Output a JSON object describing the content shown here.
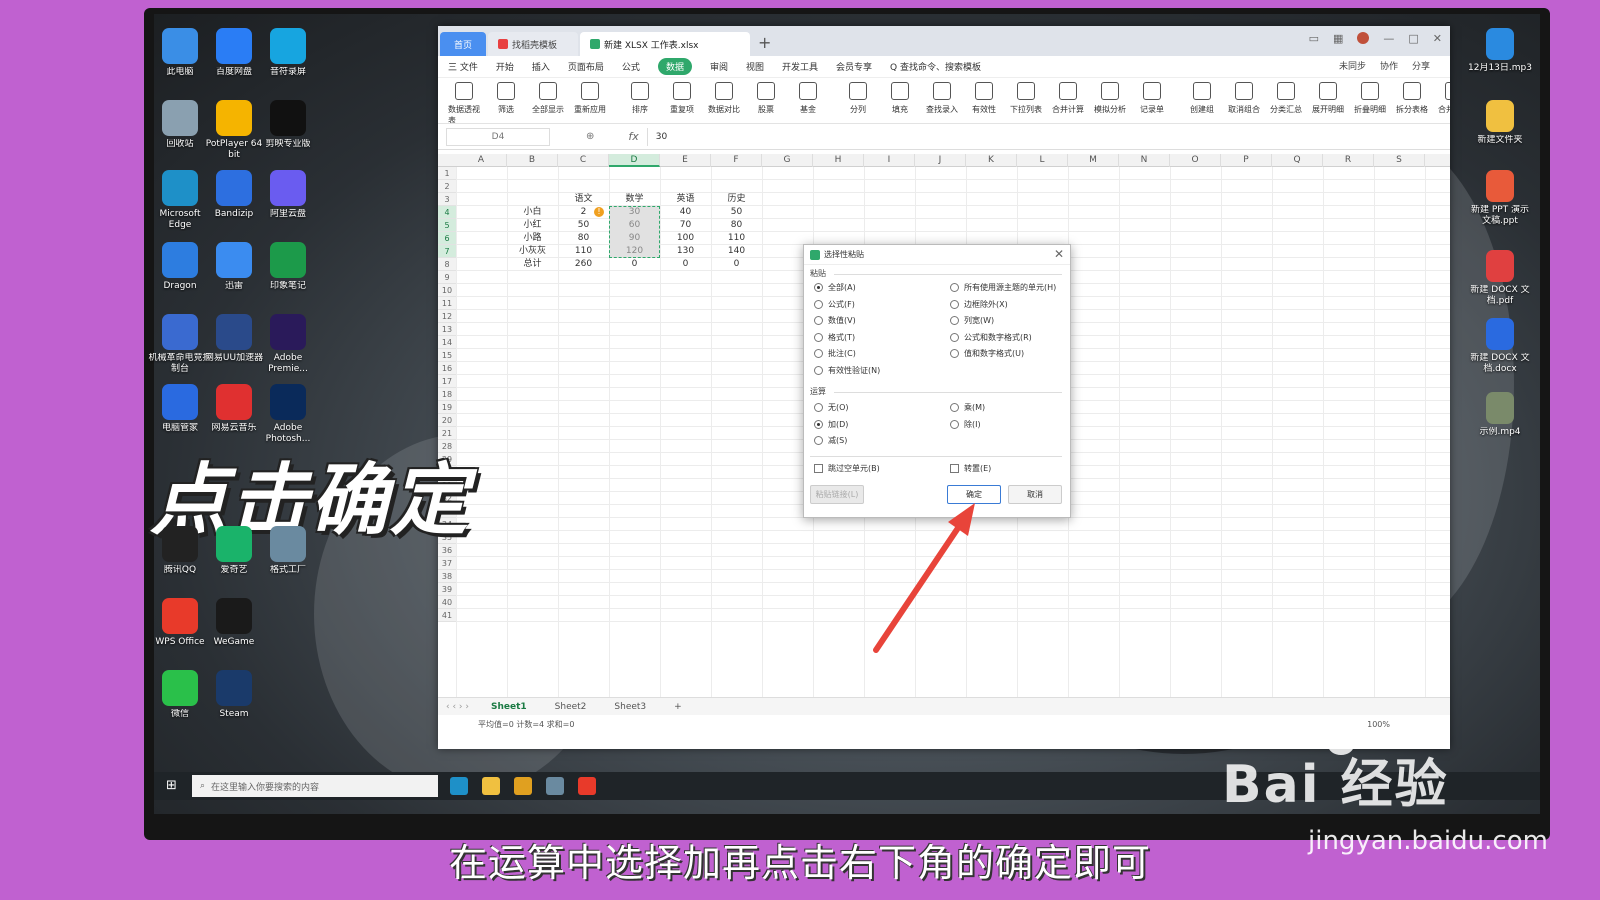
{
  "desktop": {
    "left_icons": [
      {
        "name": "此电脑",
        "color": "#3a8ee6"
      },
      {
        "name": "百度网盘",
        "color": "#2a7df5"
      },
      {
        "name": "音符录屏",
        "color": "#17a5e0"
      },
      {
        "name": "回收站",
        "color": "#8aa0b0"
      },
      {
        "name": "PotPlayer 64 bit",
        "color": "#f5b400"
      },
      {
        "name": "剪映专业版",
        "color": "#111111"
      },
      {
        "name": "Microsoft Edge",
        "color": "#1e90c8"
      },
      {
        "name": "Bandizip",
        "color": "#2d6fe0"
      },
      {
        "name": "阿里云盘",
        "color": "#6a5cf0"
      },
      {
        "name": "Dragon",
        "color": "#2d7de0"
      },
      {
        "name": "迅雷",
        "color": "#3b8cf0"
      },
      {
        "name": "印象笔记",
        "color": "#1c9a4a"
      },
      {
        "name": "机械革命电竞控制台",
        "color": "#3a6ad0"
      },
      {
        "name": "网易UU加速器",
        "color": "#2a4a8a"
      },
      {
        "name": "Adobe Premie...",
        "color": "#2a1a5a"
      },
      {
        "name": "电脑管家",
        "color": "#2a6ae0"
      },
      {
        "name": "网易云音乐",
        "color": "#e03030"
      },
      {
        "name": "Adobe Photosh...",
        "color": "#0a2a5a"
      },
      {
        "name": "腾讯QQ",
        "color": "#222222"
      },
      {
        "name": "爱奇艺",
        "color": "#1ab36a"
      },
      {
        "name": "格式工厂",
        "color": "#6a8aa0"
      },
      {
        "name": "WPS Office",
        "color": "#e83a2a"
      },
      {
        "name": "WeGame",
        "color": "#1a1a1a"
      },
      {
        "name": "微信",
        "color": "#2ac04a"
      },
      {
        "name": "Steam",
        "color": "#1a3a6a"
      }
    ],
    "right_icons": [
      {
        "name": "12月13日.mp3",
        "color": "#2a8ae0"
      },
      {
        "name": "新建文件夹",
        "color": "#f0c040"
      },
      {
        "name": "新建 PPT 演示文稿.ppt",
        "color": "#e85a3a"
      },
      {
        "name": "新建 DOCX 文档.pdf",
        "color": "#e04040"
      },
      {
        "name": "新建 DOCX 文档.docx",
        "color": "#2a6ae0"
      },
      {
        "name": "示例.mp4",
        "color": "#7a8a6a"
      }
    ]
  },
  "excel": {
    "tabs": {
      "home": "首页",
      "template": "找稻壳模板",
      "document": "新建 XLSX 工作表.xlsx"
    },
    "menu": [
      "三 文件",
      "开始",
      "插入",
      "页面布局",
      "公式",
      "数据",
      "审阅",
      "视图",
      "开发工具",
      "会员专享",
      "Q 查找命令、搜索模板"
    ],
    "active_menu": "数据",
    "menu_right": [
      "未同步",
      "协作",
      "分享"
    ],
    "ribbon": [
      "数据透视表",
      "筛选",
      "全部显示",
      "重新应用",
      "排序",
      "重复项",
      "数据对比",
      "股票",
      "基金",
      "分列",
      "填充",
      "查找录入",
      "有效性",
      "下拉列表",
      "合并计算",
      "模拟分析",
      "记录单",
      "创建组",
      "取消组合",
      "分类汇总",
      "展开明细",
      "折叠明细",
      "拆分表格",
      "合并表格"
    ],
    "name_box": "D4",
    "formula_value": "30",
    "columns": [
      "A",
      "B",
      "C",
      "D",
      "E",
      "F",
      "G",
      "H",
      "I",
      "J",
      "K",
      "L",
      "M",
      "N",
      "O",
      "P",
      "Q",
      "R",
      "S"
    ],
    "selected_column": "D",
    "row_numbers": [
      "1",
      "2",
      "3",
      "4",
      "5",
      "6",
      "7",
      "8",
      "9",
      "10",
      "11",
      "12",
      "13",
      "14",
      "15",
      "16",
      "17",
      "18",
      "19",
      "20",
      "21",
      "28",
      "29",
      "30",
      "31",
      "32",
      "33",
      "34",
      "35",
      "36",
      "37",
      "38",
      "39",
      "40",
      "41"
    ],
    "table": {
      "headers": [
        "语文",
        "数学",
        "英语",
        "历史"
      ],
      "rows": [
        {
          "name": "小白",
          "cells": [
            "2",
            "30",
            "40",
            "50"
          ]
        },
        {
          "name": "小红",
          "cells": [
            "50",
            "60",
            "70",
            "80"
          ]
        },
        {
          "name": "小路",
          "cells": [
            "80",
            "90",
            "100",
            "110"
          ]
        },
        {
          "name": "小灰灰",
          "cells": [
            "110",
            "120",
            "130",
            "140"
          ]
        },
        {
          "name": "总计",
          "cells": [
            "260",
            "0",
            "0",
            "0"
          ]
        }
      ]
    },
    "sheets": [
      "Sheet1",
      "Sheet2",
      "Sheet3"
    ],
    "active_sheet": "Sheet1",
    "status": "平均值=0  计数=4  求和=0",
    "zoom": "100%"
  },
  "dialog": {
    "title": "选择性粘贴",
    "paste_section": "粘贴",
    "paste_options_left": [
      "全部(A)",
      "公式(F)",
      "数值(V)",
      "格式(T)",
      "批注(C)",
      "有效性验证(N)"
    ],
    "paste_options_right": [
      "所有使用源主题的单元(H)",
      "边框除外(X)",
      "列宽(W)",
      "公式和数字格式(R)",
      "值和数字格式(U)"
    ],
    "operation_section": "运算",
    "operation_left": [
      "无(O)",
      "加(D)",
      "减(S)"
    ],
    "operation_right": [
      "乘(M)",
      "除(I)"
    ],
    "skip_blanks": "跳过空单元(B)",
    "transpose": "转置(E)",
    "paste_link": "粘贴链接(L)",
    "ok": "确定",
    "cancel": "取消",
    "selected_paste": "全部(A)",
    "selected_operation": "加(D)"
  },
  "overlay": {
    "big_caption": "点击确定",
    "subtitle": "在运算中选择加再点击右下角的确定即可",
    "watermark": "Bai 经验",
    "watermark_url": "jingyan.baidu.com"
  },
  "taskbar": {
    "search_placeholder": "在这里输入你要搜索的内容"
  }
}
